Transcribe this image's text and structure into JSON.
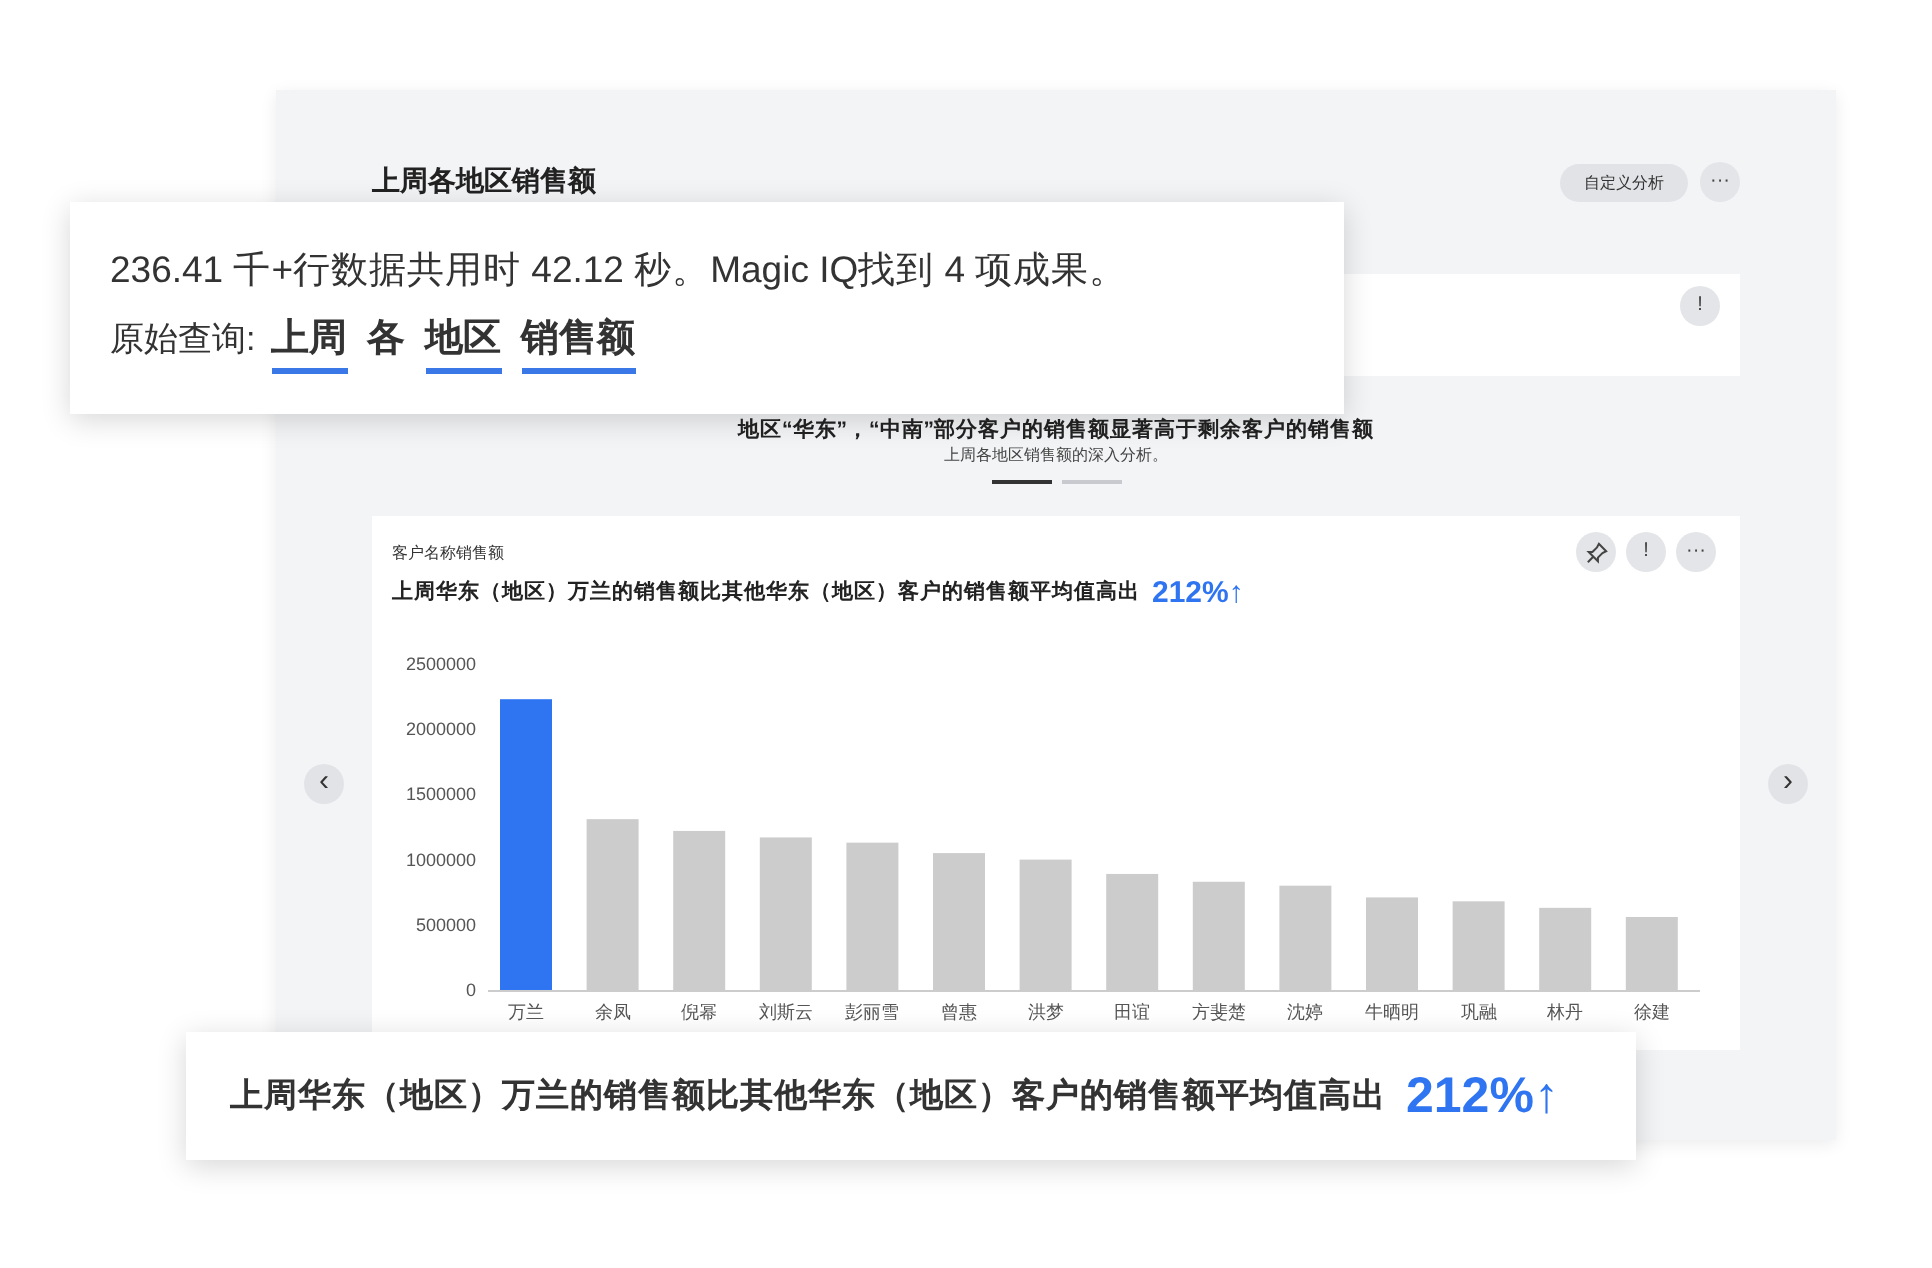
{
  "page": {
    "title": "上周各地区销售额",
    "custom_button": "自定义分析",
    "more_button": "···",
    "info_button": "!"
  },
  "insight": {
    "title": "地区“华东”，“中南”部分客户的销售额显著高于剩余客户的销售额",
    "subtitle": "上周各地区销售额的深入分析。"
  },
  "pager": [
    {
      "selected": true
    },
    {
      "selected": false
    }
  ],
  "nav": {
    "prev": "‹",
    "next": "›"
  },
  "chart_card": {
    "label": "客户名称销售额",
    "headline": "上周华东（地区）万兰的销售额比其他华东（地区）客户的销售额平均值高出",
    "figure": "212%↑",
    "buttons": [
      {
        "kind": "pin"
      },
      {
        "kind": "info",
        "text": "!"
      },
      {
        "kind": "more",
        "text": "···"
      }
    ],
    "chart_data": {
      "type": "bar",
      "categories": [
        "万兰",
        "余凤",
        "倪幂",
        "刘斯云",
        "彭丽雪",
        "曾惠",
        "洪梦",
        "田谊",
        "方斐楚",
        "沈婷",
        "牛晒明",
        "巩融",
        "林丹",
        "徐建"
      ],
      "stacked": true,
      "series": [
        {
          "color": "#2f74f0",
          "values": [
            2230000,
            null,
            null,
            null,
            null,
            null,
            null,
            null,
            null,
            null,
            null,
            null,
            null,
            null
          ]
        },
        {
          "color": "#cccccc",
          "values": [
            null,
            1310000,
            1220000,
            1170000,
            1130000,
            1050000,
            1000000,
            890000,
            830000,
            800000,
            710000,
            680000,
            630000,
            560000
          ]
        }
      ],
      "ylim": [
        0,
        2500000
      ],
      "yticks": [
        0,
        500000,
        1000000,
        1500000,
        2000000,
        2500000
      ]
    }
  },
  "query_popup": {
    "summary": "236.41 千+行数据共用时 42.12 秒。Magic IQ找到 4 项成果。",
    "label": "原始查询:",
    "tokens": [
      {
        "text": "上周",
        "underlined": true
      },
      {
        "text": "各",
        "underlined": false
      },
      {
        "text": "地区",
        "underlined": true
      },
      {
        "text": "销售额",
        "underlined": true
      }
    ]
  },
  "result_popup": {
    "text": "上周华东（地区）万兰的销售额比其他华东（地区）客户的销售额平均值高出",
    "figure": "212%↑"
  }
}
